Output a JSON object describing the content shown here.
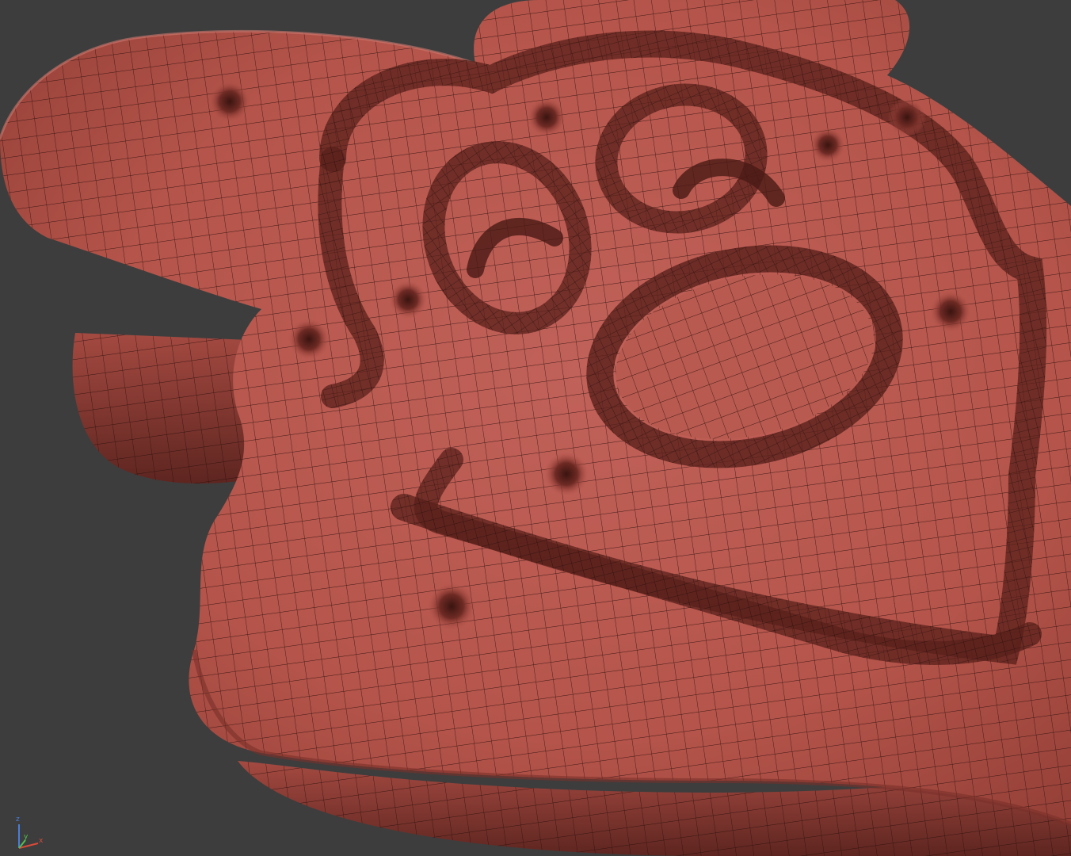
{
  "viewport": {
    "background_color": "#3d3d3d",
    "mesh_color": "#b4544a",
    "mesh_shadow_color": "#6e2a24",
    "wire_color": "#2a0f0c",
    "display_mode": "smooth-shaded-with-wireframe"
  },
  "axis_gizmo": {
    "x_label": "x",
    "y_label": "y",
    "z_label": "z",
    "x_color": "#d84a3a",
    "y_color": "#4fc24f",
    "z_color": "#4a7fd8"
  }
}
